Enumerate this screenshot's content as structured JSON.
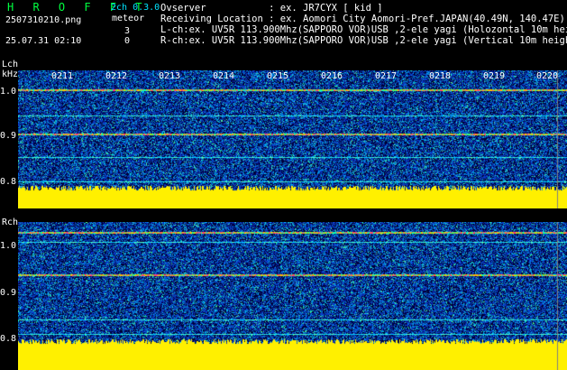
{
  "brand": "H R O F F T",
  "config": "2ch 0.3.0",
  "filename": "2507310210.png",
  "meteor_label": "meteor",
  "datetime": "25.07.31 02:10",
  "counts": {
    "l": "3",
    "r": "0"
  },
  "info": {
    "observer": "Ovserver           : ex. JR7CYX [ kid ]",
    "location": "Receiving Location : ex. Aomori City Aomori-Pref.JAPAN(40.49N, 140.47E)",
    "lch": "L-ch:ex. UV5R 113.900Mhz(SAPPORO VOR)USB ,2-ele yagi (Holozontal 10m height)",
    "rch": "R-ch:ex. UV5R 113.900Mhz(SAPPORO VOR)USB ,2-ele yagi (Vertical 10m height)"
  },
  "lch_panel": {
    "label": "Lch",
    "unit": "kHz",
    "yticks": [
      "1.0",
      "0.9",
      "0.8"
    ]
  },
  "rch_panel": {
    "label": "Rch",
    "yticks": [
      "1.0",
      "0.9",
      "0.8"
    ]
  },
  "minutes": [
    "0211",
    "0212",
    "0213",
    "0214",
    "0215",
    "0216",
    "0217",
    "0218",
    "0219",
    "0220"
  ],
  "colors": {
    "background": "#000000",
    "noise": "#1030a0",
    "signal": "#ffff00",
    "brand": "#00ff40",
    "config": "#00e5ff"
  }
}
